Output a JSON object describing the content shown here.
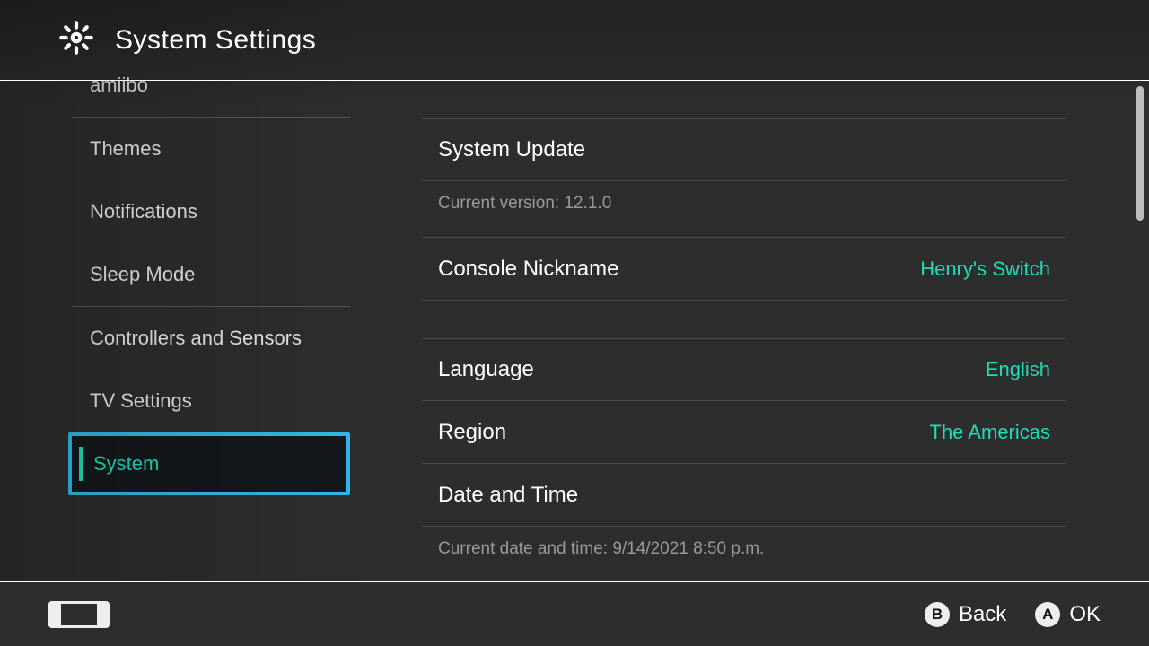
{
  "header": {
    "title": "System Settings"
  },
  "colors": {
    "accent": "#1edcb6",
    "focus": "#2fb9e6",
    "bg": "#2d2d2d"
  },
  "sidebar": {
    "selected_index": 6,
    "items": [
      {
        "label": "amiibo"
      },
      {
        "label": "Themes"
      },
      {
        "label": "Notifications"
      },
      {
        "label": "Sleep Mode"
      },
      {
        "label": "Controllers and Sensors"
      },
      {
        "label": "TV Settings"
      },
      {
        "label": "System"
      }
    ]
  },
  "main": {
    "system_update": {
      "label": "System Update",
      "subtext": "Current version: 12.1.0"
    },
    "console_nickname": {
      "label": "Console Nickname",
      "value": "Henry's Switch"
    },
    "language": {
      "label": "Language",
      "value": "English"
    },
    "region": {
      "label": "Region",
      "value": "The Americas"
    },
    "date_time": {
      "label": "Date and Time",
      "subtext": "Current date and time: 9/14/2021 8:50 p.m."
    }
  },
  "footer": {
    "back": "Back",
    "ok": "OK",
    "back_key": "B",
    "ok_key": "A"
  }
}
